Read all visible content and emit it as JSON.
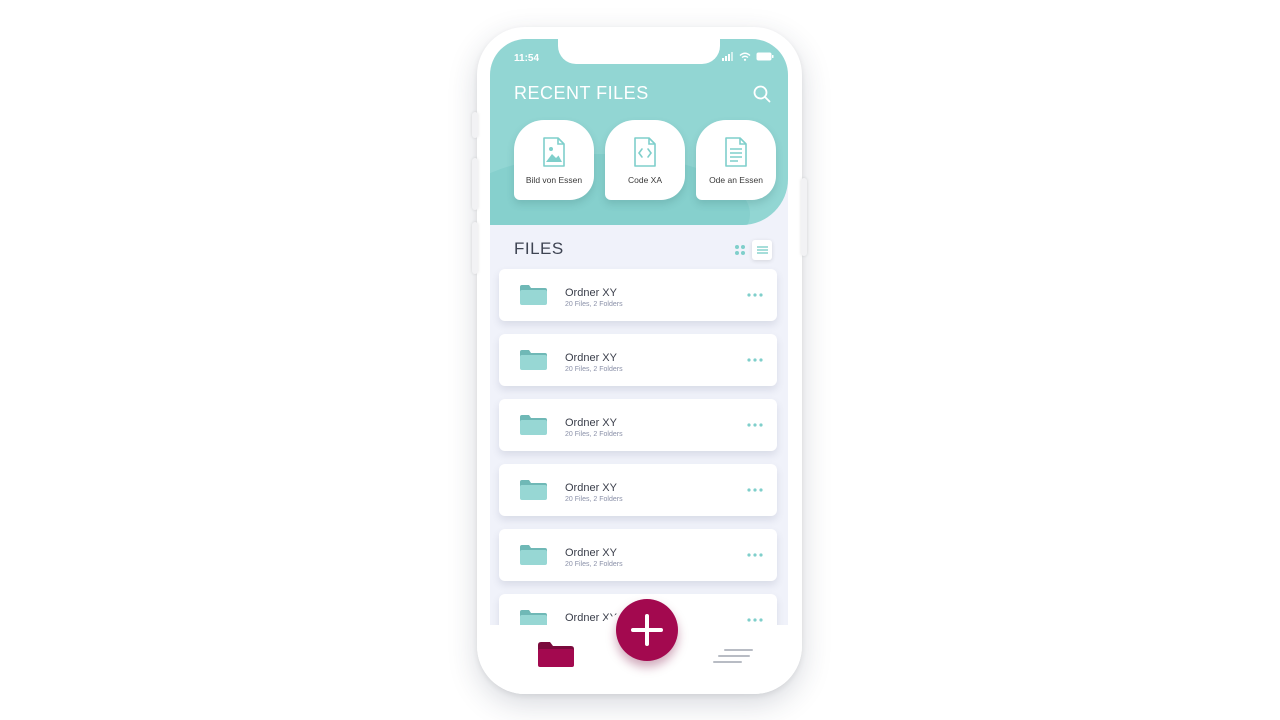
{
  "status_bar": {
    "time": "11:54"
  },
  "header": {
    "title": "RECENT FILES"
  },
  "recent_files": [
    {
      "label": "Bild von Essen",
      "icon": "image-file-icon"
    },
    {
      "label": "Code XA",
      "icon": "code-file-icon"
    },
    {
      "label": "Ode an Essen",
      "icon": "text-file-icon"
    }
  ],
  "files": {
    "title": "FILES",
    "items": [
      {
        "name": "Ordner XY",
        "meta": "20 Files, 2 Folders"
      },
      {
        "name": "Ordner XY",
        "meta": "20 Files, 2 Folders"
      },
      {
        "name": "Ordner XY",
        "meta": "20 Files, 2 Folders"
      },
      {
        "name": "Ordner XY",
        "meta": "20 Files, 2 Folders"
      },
      {
        "name": "Ordner XY",
        "meta": "20 Files, 2 Folders"
      },
      {
        "name": "Ordner XY",
        "meta": ""
      }
    ]
  },
  "colors": {
    "teal": "#92d6d3",
    "accent": "#a3094f",
    "background": "#f0f2fa"
  }
}
